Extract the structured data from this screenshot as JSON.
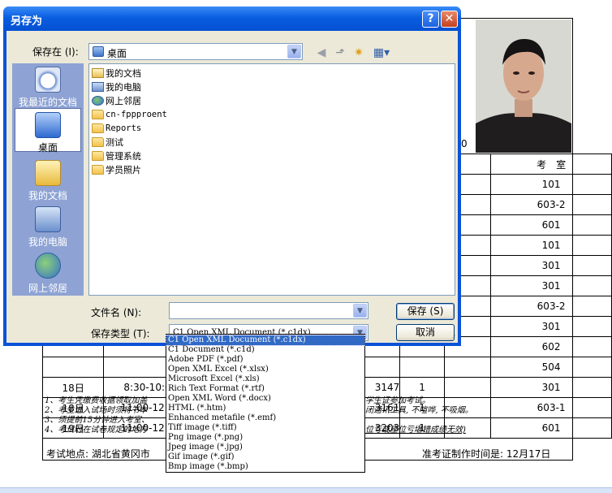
{
  "dialog": {
    "title": "另存为",
    "save_in_label": "保存在 (I):",
    "save_in_value": "桌面",
    "places": [
      {
        "label": "我最近的文档",
        "icon": "recent-documents-icon"
      },
      {
        "label": "桌面",
        "icon": "desktop-icon",
        "selected": true
      },
      {
        "label": "我的文档",
        "icon": "my-documents-icon"
      },
      {
        "label": "我的电脑",
        "icon": "my-computer-icon"
      },
      {
        "label": "网上邻居",
        "icon": "network-places-icon"
      }
    ],
    "files": [
      {
        "name": "我的文档",
        "icon": "my-documents-icon"
      },
      {
        "name": "我的电脑",
        "icon": "my-computer-icon"
      },
      {
        "name": "网上邻居",
        "icon": "network-places-icon"
      },
      {
        "name": "cn-fppproent",
        "icon": "folder-icon"
      },
      {
        "name": "Reports",
        "icon": "folder-icon"
      },
      {
        "name": "测试",
        "icon": "folder-icon"
      },
      {
        "name": "管理系统",
        "icon": "folder-icon"
      },
      {
        "name": "学员照片",
        "icon": "folder-icon"
      }
    ],
    "filename_label": "文件名 (N):",
    "filename_value": "",
    "filetype_label": "保存类型 (T):",
    "filetype_value": "C1 Open XML Document (*.c1dx)",
    "save_button": "保存 (S)",
    "cancel_button": "取消",
    "filetype_options": [
      "C1 Open XML Document (*.c1dx)",
      "C1 Document (*.c1d)",
      "Adobe PDF (*.pdf)",
      "Open XML Excel (*.xlsx)",
      "Microsoft Excel (*.xls)",
      "Rich Text Format (*.rtf)",
      "Open XML Word (*.docx)",
      "HTML (*.htm)",
      "Enhanced metafile (*.emf)",
      "Tiff image (*.tiff)",
      "Png image (*.png)",
      "Jpeg image (*.jpg)",
      "Gif image (*.gif)",
      "Bmp image (*.bmp)"
    ]
  },
  "document": {
    "photo_number": "0",
    "room_header": "考　室",
    "rows": [
      {
        "day": "",
        "time": "",
        "code": "",
        "num": "",
        "room": "101"
      },
      {
        "day": "",
        "time": "",
        "code": "",
        "num": "",
        "room": "603-2"
      },
      {
        "day": "",
        "time": "",
        "code": "",
        "num": "",
        "room": "601"
      },
      {
        "day": "",
        "time": "",
        "code": "",
        "num": "",
        "room": "101"
      },
      {
        "day": "",
        "time": "",
        "code": "",
        "num": "",
        "room": "301"
      },
      {
        "day": "",
        "time": "",
        "code": "",
        "num": "",
        "room": "301"
      },
      {
        "day": "",
        "time": "",
        "code": "",
        "num": "",
        "room": "603-2"
      },
      {
        "day": "",
        "time": "",
        "code": "",
        "num": "",
        "room": "301"
      },
      {
        "day": "",
        "time": "",
        "code": "",
        "num": "",
        "room": "602"
      },
      {
        "day": "",
        "time": "",
        "code": "",
        "num": "",
        "room": "504"
      },
      {
        "day": "18日",
        "time": "8:30-10:0",
        "code": "3147",
        "num": "1",
        "room": "301"
      },
      {
        "day": "18日",
        "time": "11:00-12:3",
        "code": "3161",
        "num": "1",
        "room": "603-1"
      },
      {
        "day": "19日",
        "time": "11:00-12:3",
        "code": "3203",
        "num": "1",
        "room": "601"
      }
    ],
    "notes": [
      "1、考生凭缴费收据领取加盖",
      "2、考生进入试场时须将书本",
      "3、须提前15分钟进入考室、",
      "4、考试时在试卷规定的地方"
    ],
    "notes_right": [
      "学生证参加考试。",
      "闭通讯工具, 不喧哗, 不吸烟。",
      "",
      "位亏或座位亏堪错成绩无效)"
    ],
    "location": "考试地点:  湖北省黄冈市",
    "made_time": "准考证制作时间是:  12月17日"
  }
}
